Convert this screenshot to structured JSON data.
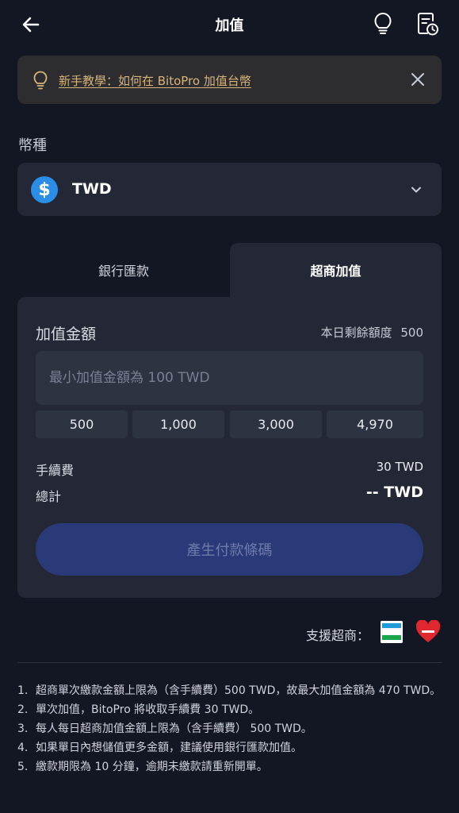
{
  "header": {
    "title": "加值",
    "back_icon": "arrow-left-icon",
    "tips_icon": "lightbulb-icon",
    "history_icon": "document-clock-icon"
  },
  "tutorial": {
    "link_text": "新手教學：如何在 BitoPro 加值台幣",
    "accent": "#d6b47c"
  },
  "currency": {
    "section_label": "幣種",
    "symbol": "$",
    "name": "TWD",
    "coin_color": "#2b8ee6"
  },
  "tabs": [
    {
      "label": "銀行匯款",
      "active": false
    },
    {
      "label": "超商加值",
      "active": true
    }
  ],
  "form": {
    "amount_label": "加值金額",
    "remaining_label": "本日剩餘額度",
    "remaining_value": "500",
    "input_value": "",
    "input_placeholder": "最小加值金額為 100 TWD",
    "quick_amounts": [
      "500",
      "1,000",
      "3,000",
      "4,970"
    ],
    "fee_label": "手續費",
    "fee_value": "30 TWD",
    "total_label": "總計",
    "total_value": "-- TWD",
    "submit_label": "產生付款條碼",
    "button_color": "#2a3a78"
  },
  "support": {
    "label": "支援超商：",
    "stores": [
      "FamilyMart",
      "Hi-Life"
    ]
  },
  "notes": [
    {
      "num": "1.",
      "text": "超商單次繳款金額上限為（含手續費）500 TWD，故最大加值金額為 470 TWD。"
    },
    {
      "num": "2.",
      "text": "單次加值，BitoPro 將收取手續費 30 TWD。"
    },
    {
      "num": "3.",
      "text": "每人每日超商加值金額上限為（含手續費） 500 TWD。"
    },
    {
      "num": "4.",
      "text": "如果單日內想儲值更多金額，建議使用銀行匯款加值。"
    },
    {
      "num": "5.",
      "text": "繳款期限為 10 分鐘，逾期未繳款請重新開單。"
    }
  ]
}
